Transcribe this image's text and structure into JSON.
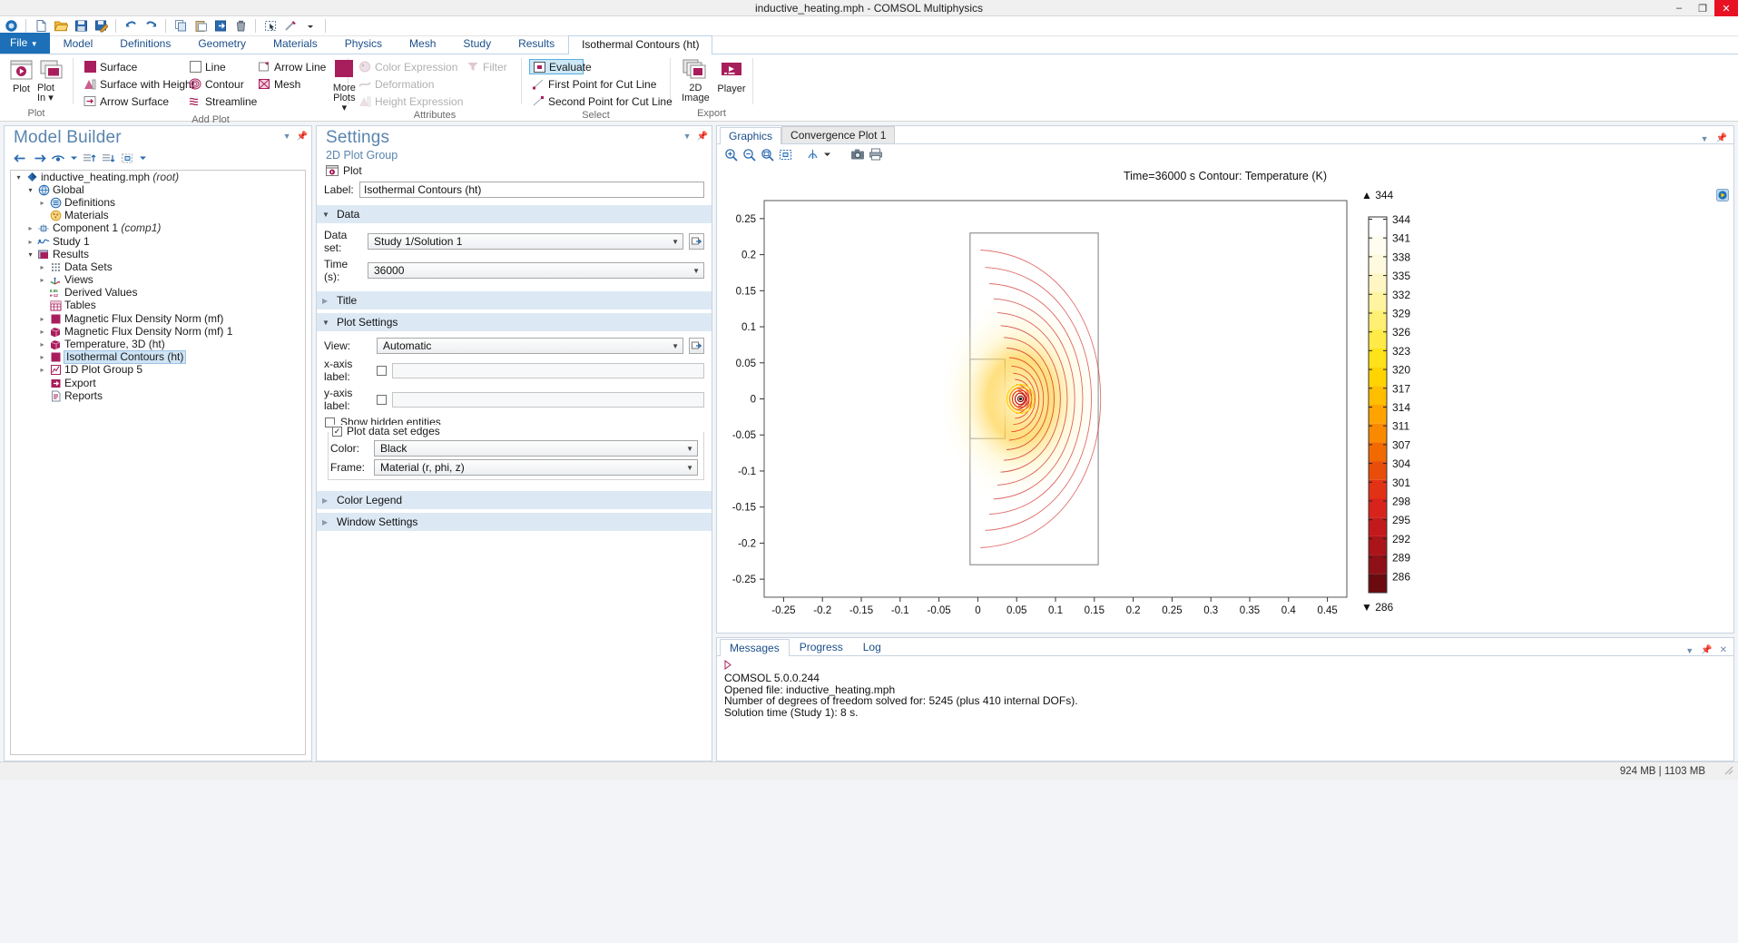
{
  "window": {
    "title": "inductive_heating.mph - COMSOL Multiphysics",
    "minimize": "–",
    "maximize": "❐",
    "close": "✕"
  },
  "quick_access": [
    {
      "name": "comsol-logo-icon",
      "glyph": ""
    },
    {
      "name": "new-file-icon"
    },
    {
      "name": "open-folder-icon"
    },
    {
      "name": "save-icon"
    },
    {
      "name": "save-as-icon"
    },
    {
      "name": "undo-icon"
    },
    {
      "name": "redo-icon"
    },
    {
      "name": "copy-icon"
    },
    {
      "name": "paste-icon"
    },
    {
      "name": "export-icon"
    },
    {
      "name": "delete-icon"
    },
    {
      "name": "select-box-icon"
    },
    {
      "name": "measure-icon"
    },
    {
      "name": "qat-dropdown-icon"
    }
  ],
  "ribbon": {
    "tabs": [
      {
        "label": "File",
        "state": "file"
      },
      {
        "label": "Model",
        "state": "normal"
      },
      {
        "label": "Definitions",
        "state": "normal"
      },
      {
        "label": "Geometry",
        "state": "normal"
      },
      {
        "label": "Materials",
        "state": "normal"
      },
      {
        "label": "Physics",
        "state": "normal"
      },
      {
        "label": "Mesh",
        "state": "normal"
      },
      {
        "label": "Study",
        "state": "normal"
      },
      {
        "label": "Results",
        "state": "normal"
      },
      {
        "label": "Isothermal Contours (ht)",
        "state": "active"
      }
    ],
    "groups": [
      {
        "label": "Plot",
        "big": [
          {
            "label": "Plot",
            "icon": "plot-icon"
          },
          {
            "label": "Plot In ▾",
            "icon": "plot-in-icon"
          }
        ]
      },
      {
        "label": "Add Plot",
        "columns": [
          [
            {
              "label": "Surface",
              "icon": "surface-icon",
              "disabled": false
            },
            {
              "label": "Surface with Height",
              "icon": "surface-height-icon",
              "disabled": false
            },
            {
              "label": "Arrow Surface",
              "icon": "arrow-surface-icon",
              "disabled": false
            }
          ],
          [
            {
              "label": "Line",
              "icon": "line-icon",
              "disabled": false
            },
            {
              "label": "Contour",
              "icon": "contour-icon",
              "disabled": false
            },
            {
              "label": "Streamline",
              "icon": "streamline-icon",
              "disabled": false
            }
          ],
          [
            {
              "label": "Arrow Line",
              "icon": "arrow-line-icon",
              "disabled": false
            },
            {
              "label": "Mesh",
              "icon": "mesh-icon",
              "disabled": false
            }
          ]
        ],
        "more": {
          "label": "More Plots ▾",
          "icon": "more-plots-icon"
        }
      },
      {
        "label": "Attributes",
        "columns": [
          [
            {
              "label": "Color Expression",
              "icon": "color-expression-icon",
              "disabled": true
            },
            {
              "label": "Deformation",
              "icon": "deformation-icon",
              "disabled": true
            },
            {
              "label": "Height Expression",
              "icon": "height-expression-icon",
              "disabled": true
            }
          ],
          [
            {
              "label": "Filter",
              "icon": "filter-icon",
              "disabled": true
            }
          ]
        ]
      },
      {
        "label": "Select",
        "columns": [
          [
            {
              "label": "Evaluate",
              "icon": "evaluate-icon",
              "selected": true
            },
            {
              "label": "First Point for Cut Line",
              "icon": "first-point-cut-line-icon"
            },
            {
              "label": "Second Point for Cut Line",
              "icon": "second-point-cut-line-icon"
            }
          ]
        ]
      },
      {
        "label": "Export",
        "big": [
          {
            "label": "2D Image",
            "icon": "2d-image-icon"
          },
          {
            "label": "Player",
            "icon": "player-icon"
          }
        ]
      }
    ]
  },
  "model_builder": {
    "title": "Model Builder",
    "toolbar": [
      {
        "name": "back-arrow-icon"
      },
      {
        "name": "forward-arrow-icon"
      },
      {
        "name": "show-eye-icon"
      },
      {
        "name": "show-dropdown-icon"
      },
      {
        "name": "collapse-all-icon"
      },
      {
        "name": "expand-all-icon"
      },
      {
        "name": "node-group-icon"
      },
      {
        "name": "node-group-dropdown-icon"
      }
    ],
    "tree": [
      {
        "label": "inductive_heating.mph",
        "suffix": " (root)",
        "depth": 0,
        "arrow": "open",
        "icon": "root-icon",
        "selected": false
      },
      {
        "label": "Global",
        "suffix": "",
        "depth": 1,
        "arrow": "open",
        "icon": "global-icon",
        "selected": false
      },
      {
        "label": "Definitions",
        "suffix": "",
        "depth": 2,
        "arrow": "closed",
        "icon": "definitions-icon",
        "selected": false
      },
      {
        "label": "Materials",
        "suffix": "",
        "depth": 2,
        "arrow": "none",
        "icon": "materials-icon",
        "selected": false
      },
      {
        "label": "Component 1",
        "suffix": " (comp1)",
        "depth": 1,
        "arrow": "closed",
        "icon": "component-icon",
        "selected": false
      },
      {
        "label": "Study 1",
        "suffix": "",
        "depth": 1,
        "arrow": "closed",
        "icon": "study-icon",
        "selected": false
      },
      {
        "label": "Results",
        "suffix": "",
        "depth": 1,
        "arrow": "open",
        "icon": "results-icon",
        "selected": false
      },
      {
        "label": "Data Sets",
        "suffix": "",
        "depth": 2,
        "arrow": "closed",
        "icon": "datasets-icon",
        "selected": false
      },
      {
        "label": "Views",
        "suffix": "",
        "depth": 2,
        "arrow": "closed",
        "icon": "views-icon",
        "selected": false
      },
      {
        "label": "Derived Values",
        "suffix": "",
        "depth": 2,
        "arrow": "none",
        "icon": "derived-values-icon",
        "selected": false
      },
      {
        "label": "Tables",
        "suffix": "",
        "depth": 2,
        "arrow": "none",
        "icon": "tables-icon",
        "selected": false
      },
      {
        "label": "Magnetic Flux Density Norm (mf)",
        "suffix": "",
        "depth": 2,
        "arrow": "closed",
        "icon": "plot2d-icon",
        "selected": false
      },
      {
        "label": "Magnetic Flux Density Norm (mf) 1",
        "suffix": "",
        "depth": 2,
        "arrow": "closed",
        "icon": "plot3d-icon",
        "selected": false
      },
      {
        "label": "Temperature, 3D (ht)",
        "suffix": "",
        "depth": 2,
        "arrow": "closed",
        "icon": "plot3d-icon",
        "selected": false
      },
      {
        "label": "Isothermal Contours (ht)",
        "suffix": "",
        "depth": 2,
        "arrow": "closed",
        "icon": "plot2d-icon",
        "selected": true
      },
      {
        "label": "1D Plot Group 5",
        "suffix": "",
        "depth": 2,
        "arrow": "closed",
        "icon": "plot1d-icon",
        "selected": false
      },
      {
        "label": "Export",
        "suffix": "",
        "depth": 2,
        "arrow": "none",
        "icon": "export-node-icon",
        "selected": false
      },
      {
        "label": "Reports",
        "suffix": "",
        "depth": 2,
        "arrow": "none",
        "icon": "reports-icon",
        "selected": false
      }
    ]
  },
  "settings": {
    "title": "Settings",
    "subtitle": "2D Plot Group",
    "plot_button": "Plot",
    "label_caption": "Label:",
    "label_value": "Isothermal Contours (ht)",
    "sections": {
      "data": {
        "title": "Data",
        "expanded": true,
        "dataset_caption": "Data set:",
        "dataset_value": "Study 1/Solution 1",
        "time_caption": "Time (s):",
        "time_value": "36000"
      },
      "title_section": {
        "title": "Title",
        "expanded": false
      },
      "plot_settings": {
        "title": "Plot Settings",
        "expanded": true,
        "view_caption": "View:",
        "view_value": "Automatic",
        "x_axis_caption": "x-axis label:",
        "x_axis_value": "",
        "x_axis_checked": false,
        "y_axis_caption": "y-axis label:",
        "y_axis_value": "",
        "y_axis_checked": false,
        "show_hidden_caption": "Show hidden entities",
        "show_hidden_checked": false,
        "plot_edges_caption": "Plot data set edges",
        "plot_edges_checked": true,
        "color_caption": "Color:",
        "color_value": "Black",
        "frame_caption": "Frame:",
        "frame_value": "Material  (r, phi, z)"
      },
      "color_legend": {
        "title": "Color Legend",
        "expanded": false
      },
      "window_settings": {
        "title": "Window Settings",
        "expanded": false
      }
    }
  },
  "graphics": {
    "tabs": [
      {
        "label": "Graphics",
        "active": true
      },
      {
        "label": "Convergence Plot 1",
        "active": false
      }
    ],
    "toolbar": [
      {
        "name": "zoom-in-icon"
      },
      {
        "name": "zoom-out-icon"
      },
      {
        "name": "zoom-box-icon"
      },
      {
        "name": "zoom-extents-icon"
      },
      {
        "name": "transparency-icon"
      },
      {
        "name": "transparency-dropdown-icon"
      },
      {
        "name": "camera-icon"
      },
      {
        "name": "print-icon"
      }
    ],
    "plot_title": "Time=36000 s  Contour: Temperature (K)",
    "max_marker": "▲ 344",
    "min_marker": "▼ 286"
  },
  "chart_data": {
    "type": "contour",
    "title": "Time=36000 s  Contour: Temperature (K)",
    "xlabel": "",
    "ylabel": "",
    "xlim": [
      -0.275,
      0.475
    ],
    "ylim": [
      -0.275,
      0.275
    ],
    "xticks": [
      "-0.25",
      "-0.2",
      "-0.15",
      "-0.1",
      "-0.05",
      "0",
      "0.05",
      "0.1",
      "0.15",
      "0.2",
      "0.25",
      "0.3",
      "0.35",
      "0.4",
      "0.45"
    ],
    "yticks": [
      "0.25",
      "0.2",
      "0.15",
      "0.1",
      "0.05",
      "0",
      "-0.05",
      "-0.1",
      "-0.15",
      "-0.2",
      "-0.25"
    ],
    "legend_title": "",
    "legend_position": "right",
    "legend_max_label": "344",
    "legend_min_label": "286",
    "legend_ticks": [
      344,
      341,
      338,
      335,
      332,
      329,
      326,
      323,
      320,
      317,
      314,
      311,
      307,
      304,
      301,
      298,
      295,
      292,
      289,
      286
    ],
    "legend_colors": [
      "#ffffff",
      "#fffdf0",
      "#fffadf",
      "#fff6c4",
      "#fff49f",
      "#ffef72",
      "#ffea47",
      "#ffe219",
      "#ffd400",
      "#ffbe00",
      "#ffa300",
      "#f98a00",
      "#f06a00",
      "#e84d0a",
      "#e23216",
      "#d8231c",
      "#c21a1c",
      "#ab1419",
      "#8f1016",
      "#6b0b10"
    ]
  },
  "messages": {
    "tabs": [
      {
        "label": "Messages",
        "active": true
      },
      {
        "label": "Progress",
        "active": false
      },
      {
        "label": "Log",
        "active": false
      }
    ],
    "lines": [
      "COMSOL 5.0.0.244",
      "Opened file: inductive_heating.mph",
      "Number of degrees of freedom solved for: 5245 (plus 410 internal DOFs).",
      "Solution time (Study 1): 8 s."
    ]
  },
  "status_bar": {
    "memory": "924 MB | 1103 MB"
  },
  "colors": {
    "accent_magenta": "#a81e5c",
    "ribbon_blue": "#1d6fb8",
    "section_header": "#dce9f5",
    "selection": "#cfe4f5"
  }
}
